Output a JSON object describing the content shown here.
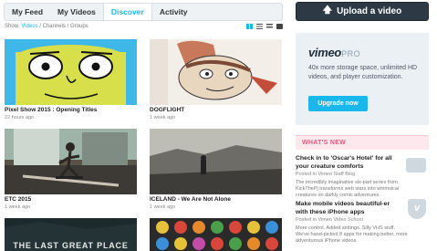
{
  "tabs": [
    {
      "label": "My Feed"
    },
    {
      "label": "My Videos"
    },
    {
      "label": "Discover"
    },
    {
      "label": "Activity"
    }
  ],
  "filter": {
    "show_label": "Show:",
    "videos": "Videos",
    "sep1": "/",
    "channels": "Channels",
    "sep2": "/",
    "groups": "Groups"
  },
  "videos": [
    {
      "title": "Pixel Show 2015 : Opening Titles",
      "meta": "22 hours ago"
    },
    {
      "title": "DOGFLIGHT",
      "meta": "1 week ago"
    },
    {
      "title": "ETC 2015",
      "meta": "1 week ago"
    },
    {
      "title": "ICELAND - We Are Not Alone",
      "meta": "1 week ago"
    },
    {
      "title": "",
      "meta": "",
      "overlay": "THE LAST GREAT PLACE"
    },
    {
      "title": "",
      "meta": ""
    }
  ],
  "upload": {
    "label": "Upload a video",
    "icon": "arrow-up-icon"
  },
  "pro_ad": {
    "logo": "vimeo",
    "logo_suffix": "PRO",
    "description": "40x more storage space, unlimited HD videos, and player customization.",
    "button": "Upgrade now"
  },
  "whats_new": {
    "heading": "WHAT'S NEW",
    "items": [
      {
        "title": "Check in to 'Oscar's Hotel' for all your creature comforts",
        "source": "Posted in Vimeo Staff Blog",
        "desc": "The incredibly imaginative six-part series from KickThePj transforms web stars into whimsical creatures on darkly comic adventures."
      },
      {
        "title": "Make mobile videos beautiful-er with these iPhone apps",
        "source": "Posted in Vimeo Video School",
        "desc": "More control. Added settings. Silly VHS stuff. We've hand-picked 8 apps for making better, more adventurous iPhone videos."
      }
    ]
  },
  "colors": {
    "accent": "#1ab7ea",
    "upload_bg": "#2d3a46",
    "whats_new": "#e3587d"
  }
}
